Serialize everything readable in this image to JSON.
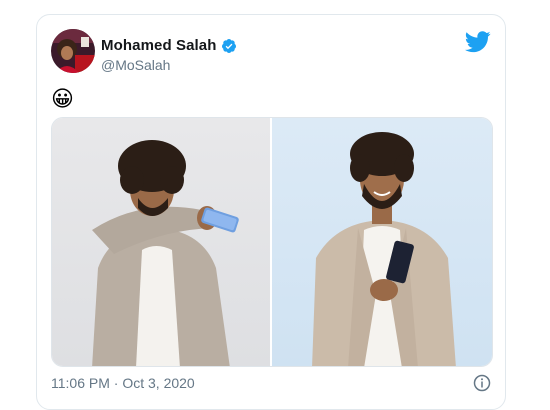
{
  "tweet": {
    "author_name": "Mohamed Salah",
    "author_handle": "@MoSalah",
    "verified": true,
    "text": "😀",
    "time": "11:06 PM",
    "separator": "·",
    "date": "Oct 3, 2020",
    "media_count": 2
  },
  "icons": {
    "brand": "twitter-bird-icon",
    "verified": "verified-badge-icon",
    "info": "info-icon"
  },
  "colors": {
    "brand": "#1da1f2",
    "name": "#14171a",
    "secondary": "#657786",
    "border": "#e1e8ed"
  }
}
